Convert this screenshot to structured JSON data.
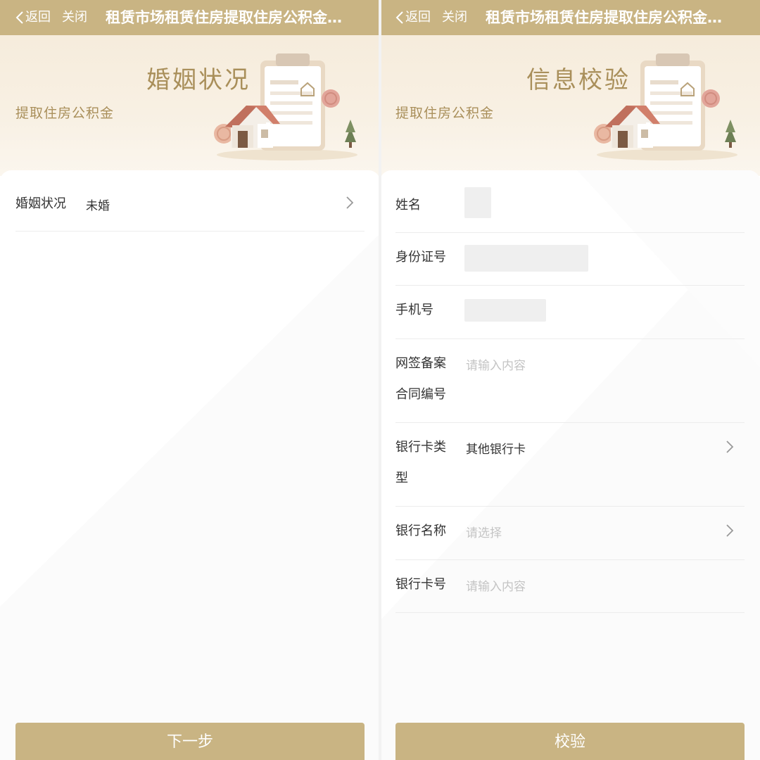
{
  "left": {
    "nav": {
      "back": "返回",
      "close": "关闭",
      "title": "租赁市场租赁住房提取住房公积金…"
    },
    "banner": {
      "title": "婚姻状况",
      "subtitle": "提取住房公积金"
    },
    "marital": {
      "label": "婚姻状况",
      "value": "未婚"
    },
    "button": "下一步"
  },
  "right": {
    "nav": {
      "back": "返回",
      "close": "关闭",
      "title": "租赁市场租赁住房提取住房公积金…"
    },
    "banner": {
      "title": "信息校验",
      "subtitle": "提取住房公积金"
    },
    "fields": {
      "name": {
        "label": "姓名"
      },
      "id_number": {
        "label": "身份证号"
      },
      "phone": {
        "label": "手机号"
      },
      "contract": {
        "label_line1": "网签备案",
        "label_line2": "合同编号",
        "placeholder": "请输入内容"
      },
      "card_type": {
        "label_line1": "银行卡类",
        "label_line2": "型",
        "value": "其他银行卡"
      },
      "bank_name": {
        "label": "银行名称",
        "placeholder": "请选择"
      },
      "card_number": {
        "label": "银行卡号",
        "placeholder": "请输入内容"
      }
    },
    "button": "校验"
  },
  "colors": {
    "accent": "#c9b483",
    "banner_text": "#a98f5a",
    "placeholder": "#c4c4c4"
  },
  "icons": [
    "chevron-left-icon",
    "chevron-right-icon",
    "clipboard-house-illustration"
  ]
}
